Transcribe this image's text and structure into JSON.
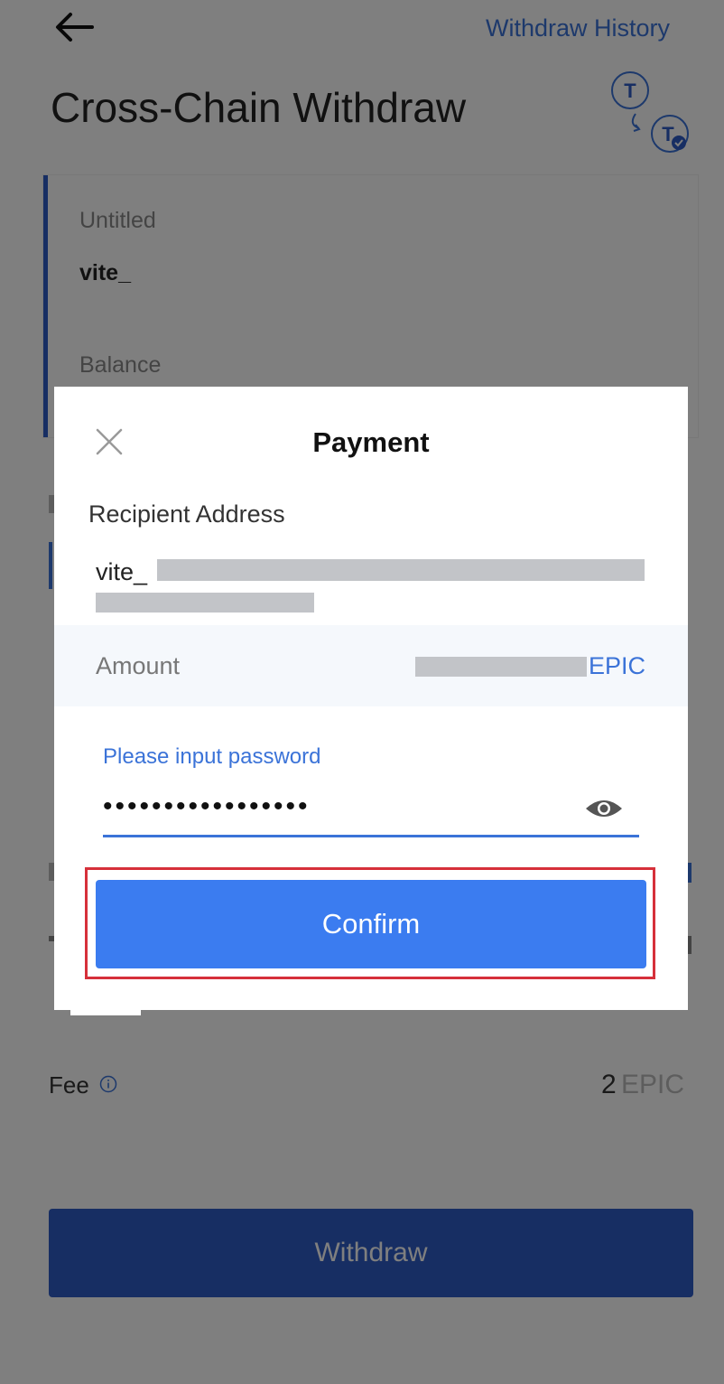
{
  "header": {
    "withdraw_history": "Withdraw History",
    "title": "Cross-Chain Withdraw"
  },
  "card": {
    "wallet_name": "Untitled",
    "address_prefix": "vite_",
    "balance_label": "Balance"
  },
  "fee": {
    "label": "Fee",
    "amount": "2",
    "unit": "EPIC"
  },
  "withdraw_button": "Withdraw",
  "modal": {
    "title": "Payment",
    "recipient_label": "Recipient Address",
    "recipient_prefix": "vite_",
    "amount_label": "Amount",
    "amount_unit": "EPIC",
    "password_label": "Please input password",
    "password_value": "•••••••••••••••••",
    "confirm": "Confirm"
  },
  "colors": {
    "accent": "#3b73d8",
    "confirm_button": "#3b7cf0",
    "highlight_border": "#d6303a",
    "overlay": "rgba(0,0,0,0.5)"
  },
  "icons": [
    "back-arrow-icon",
    "token-transfer-icon",
    "info-icon",
    "close-icon",
    "eye-icon"
  ]
}
